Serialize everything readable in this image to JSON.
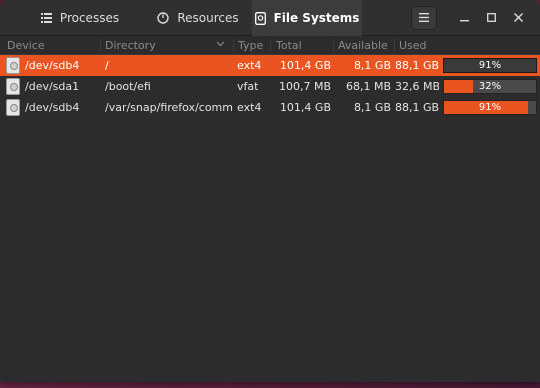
{
  "tabs": {
    "processes": "Processes",
    "resources": "Resources",
    "file_systems": "File Systems"
  },
  "columns": {
    "device": "Device",
    "directory": "Directory",
    "type": "Type",
    "total": "Total",
    "available": "Available",
    "used": "Used"
  },
  "rows": [
    {
      "device": "/dev/sdb4",
      "directory": "/",
      "type": "ext4",
      "total": "101,4 GB",
      "available": "8,1 GB",
      "used": "88,1 GB",
      "percent": "91%",
      "fraction": 0.91
    },
    {
      "device": "/dev/sda1",
      "directory": "/boot/efi",
      "type": "vfat",
      "total": "100,7 MB",
      "available": "68,1 MB",
      "used": "32,6 MB",
      "percent": "32%",
      "fraction": 0.32
    },
    {
      "device": "/dev/sdb4",
      "directory": "/var/snap/firefox/commc",
      "type": "ext4",
      "total": "101,4 GB",
      "available": "8,1 GB",
      "used": "88,1 GB",
      "percent": "91%",
      "fraction": 0.91
    }
  ],
  "colors": {
    "accent": "#e95420",
    "background": "#2c2c2c"
  }
}
